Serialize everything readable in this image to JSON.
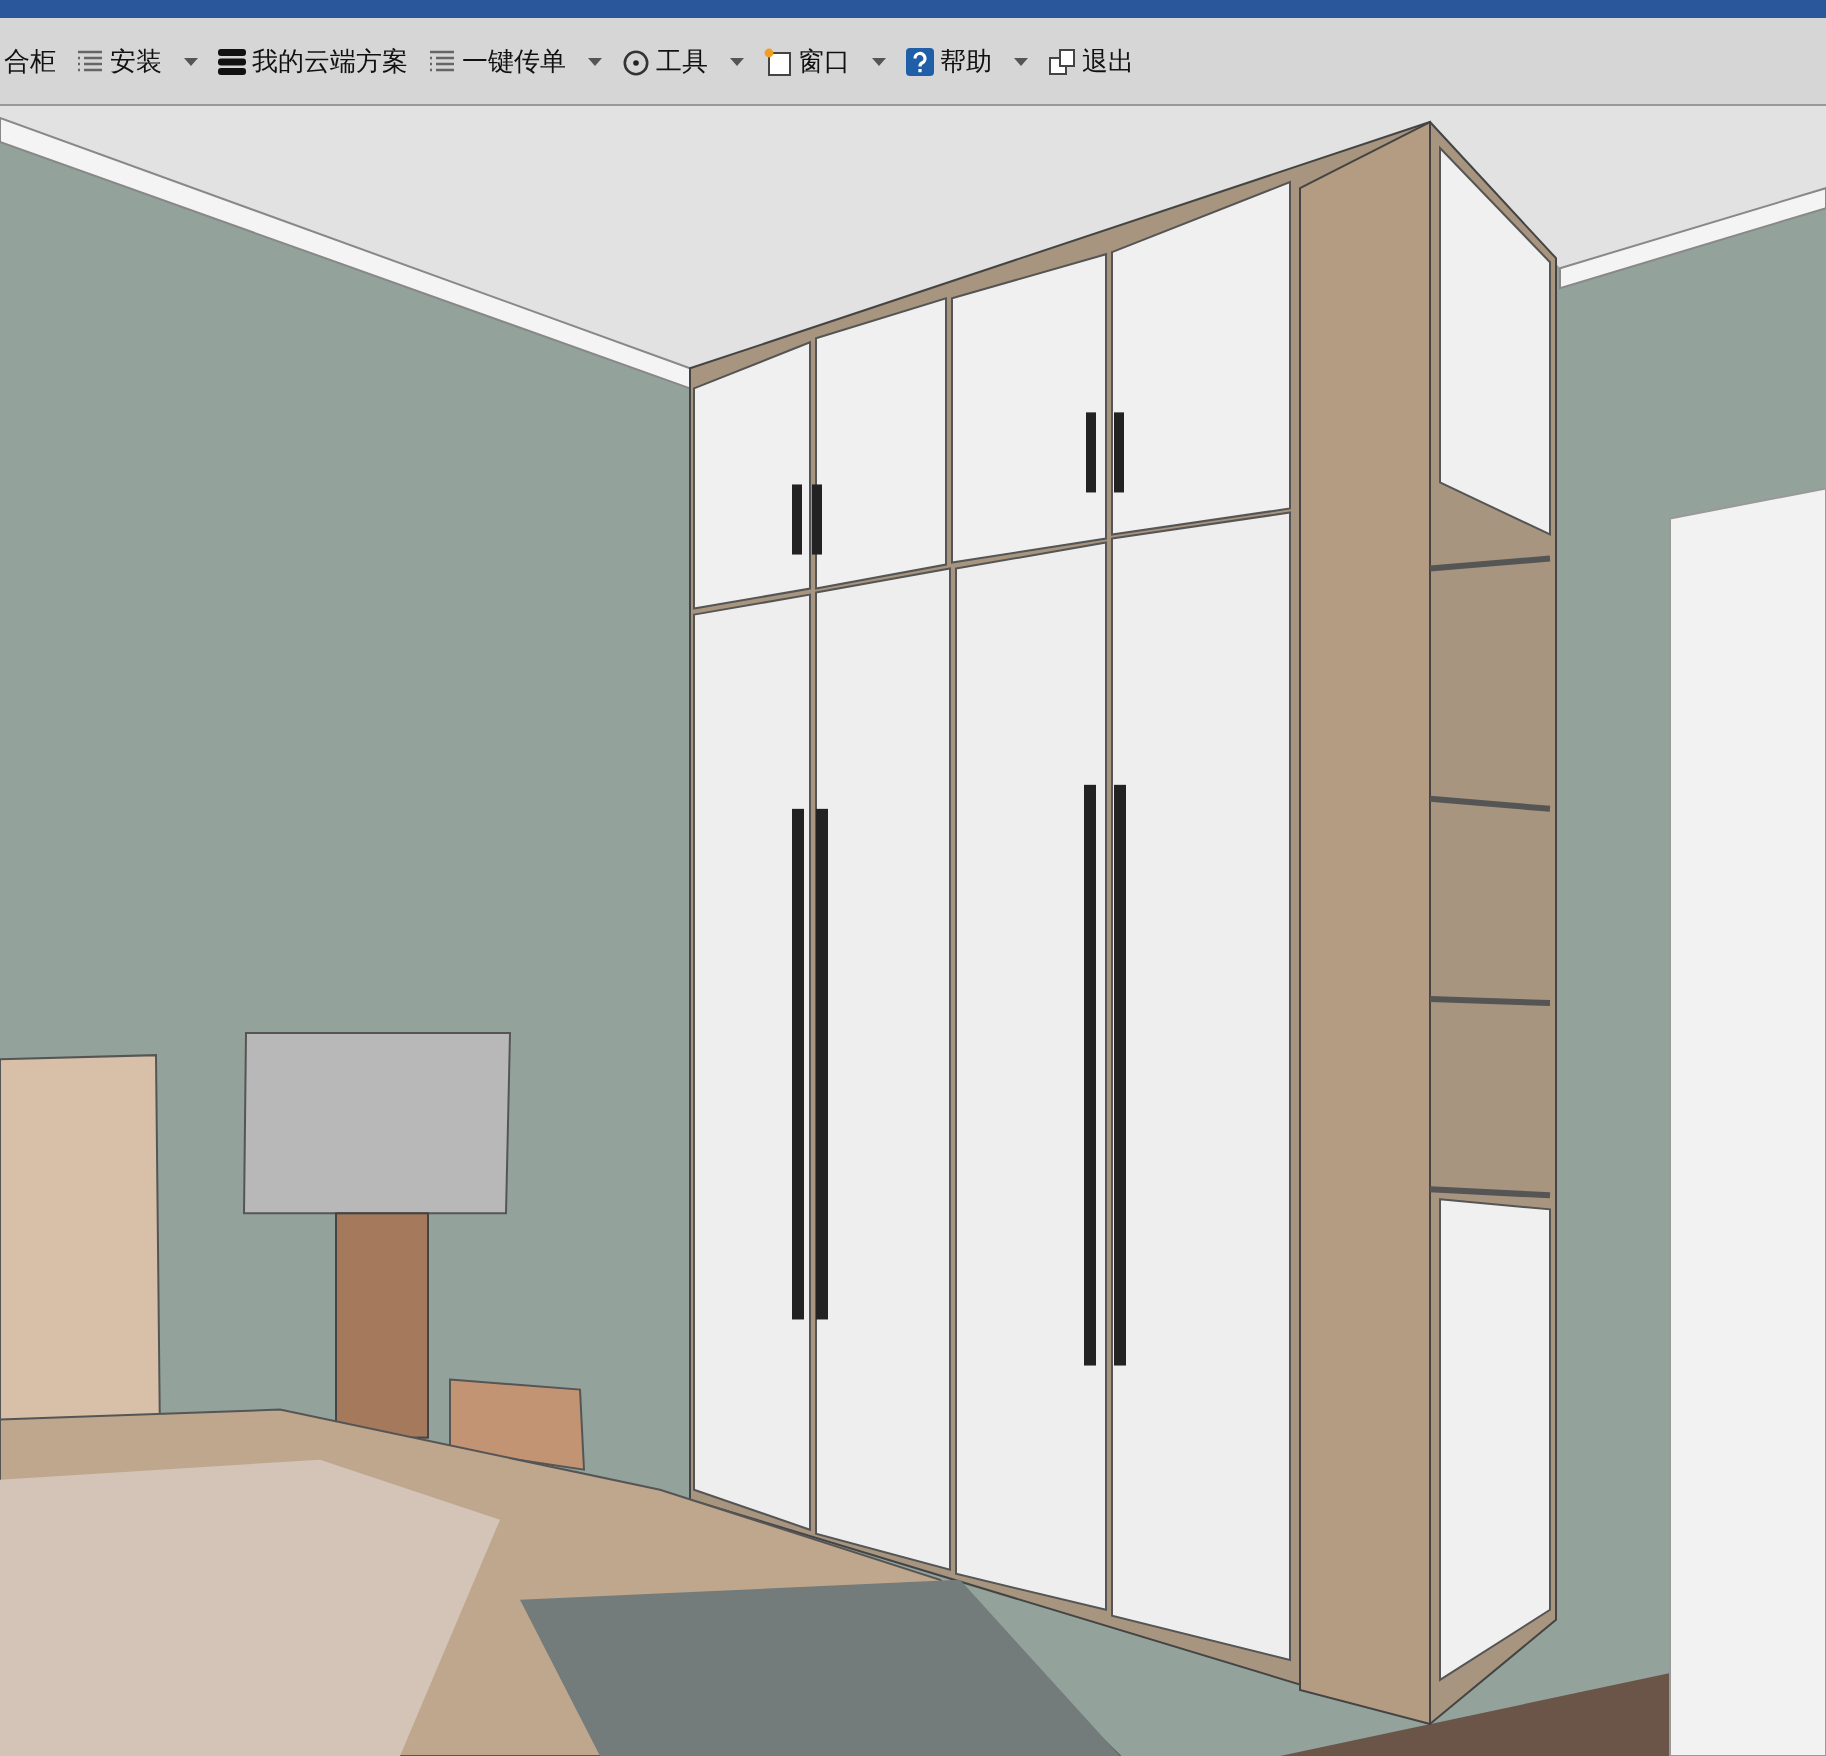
{
  "toolbar": {
    "items": [
      {
        "label": "合柜",
        "kind": "none",
        "has_menu": false
      },
      {
        "label": "安装",
        "kind": "list",
        "has_menu": true
      },
      {
        "label": "我的云端方案",
        "kind": "stack",
        "has_menu": false
      },
      {
        "label": "一键传单",
        "kind": "list",
        "has_menu": true
      },
      {
        "label": "工具",
        "kind": "dial",
        "has_menu": true
      },
      {
        "label": "窗口",
        "kind": "window",
        "has_menu": true
      },
      {
        "label": "帮助",
        "kind": "help",
        "has_menu": true
      },
      {
        "label": "退出",
        "kind": "exit",
        "has_menu": false
      }
    ]
  }
}
